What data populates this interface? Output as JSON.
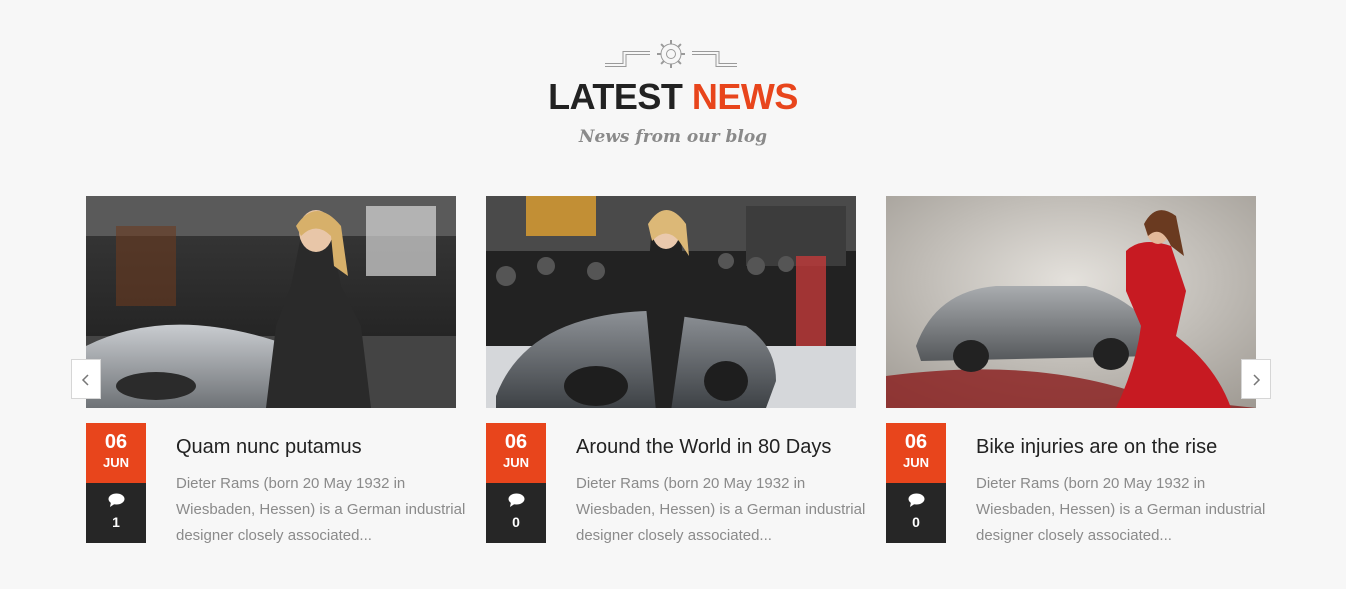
{
  "section": {
    "title_part1": "LATEST",
    "title_part2": "NEWS",
    "subtitle": "News from our blog",
    "ornament_icon": "gear-icon",
    "accent_color": "#e8451c"
  },
  "nav": {
    "prev_icon": "chevron-left-icon",
    "next_icon": "chevron-right-icon"
  },
  "posts": [
    {
      "image_alt": "Woman in black coat beside silver convertible at motor show",
      "day": "06",
      "month": "JUN",
      "comment_count": "1",
      "title": "Quam nunc putamus",
      "excerpt": "Dieter Rams (born 20 May 1932 in Wiesbaden, Hessen) is a German industrial designer closely associated..."
    },
    {
      "image_alt": "Woman standing beside grey convertible at auto show crowd",
      "day": "06",
      "month": "JUN",
      "comment_count": "0",
      "title": "Around the World in 80 Days",
      "excerpt": "Dieter Rams (born 20 May 1932 in Wiesbaden, Hessen) is a German industrial designer closely associated..."
    },
    {
      "image_alt": "Woman in red dress beside silver coupe",
      "day": "06",
      "month": "JUN",
      "comment_count": "0",
      "title": "Bike injuries are on the rise",
      "excerpt": "Dieter Rams (born 20 May 1932 in Wiesbaden, Hessen) is a German industrial designer closely associated..."
    }
  ]
}
